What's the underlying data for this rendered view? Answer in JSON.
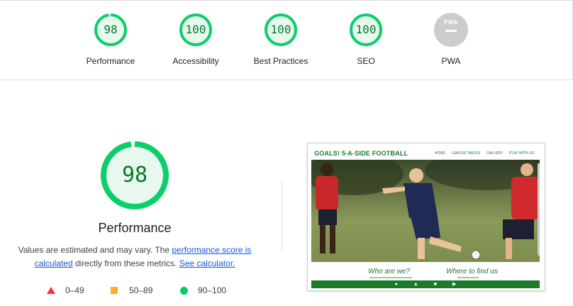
{
  "summary": {
    "items": [
      {
        "score": "98",
        "label": "Performance",
        "color": "#0cce6b"
      },
      {
        "score": "100",
        "label": "Accessibility",
        "color": "#0cce6b"
      },
      {
        "score": "100",
        "label": "Best Practices",
        "color": "#0cce6b"
      },
      {
        "score": "100",
        "label": "SEO",
        "color": "#0cce6b"
      },
      {
        "score": "PWA",
        "label": "PWA",
        "color": "#cccccc"
      }
    ]
  },
  "main": {
    "score": "98",
    "title": "Performance",
    "desc_prefix": "Values are estimated and may vary. The ",
    "link_score": "performance score is calculated",
    "desc_middle": " directly from these metrics. ",
    "link_calc": "See calculator."
  },
  "legend": {
    "fail": "0–49",
    "average": "50–89",
    "pass": "90–100"
  },
  "screenshot": {
    "brand": "GOALS! 5-A-SIDE FOOTBALL",
    "nav": [
      "HOME",
      "LEAGUE TABLES",
      "GALLERY",
      "PLAY WITH US"
    ],
    "section_left": "Who are we?",
    "section_right": "Where to find us",
    "footer_icons": [
      "facebook-icon",
      "twitter-icon",
      "instagram-icon",
      "youtube-icon"
    ]
  },
  "colors": {
    "pass": "#0cce6b",
    "pass_text": "#0a7a28",
    "average": "#ffaa33",
    "fail": "#ff3333",
    "link": "#1a56db",
    "brand_green": "#1b7a2b"
  }
}
